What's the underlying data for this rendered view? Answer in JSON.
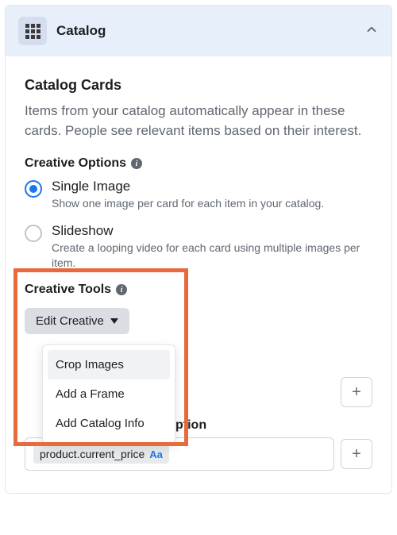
{
  "header": {
    "title": "Catalog"
  },
  "cards": {
    "title": "Catalog Cards",
    "description": "Items from your catalog automatically appear in these cards. People see relevant items based on their interest."
  },
  "creative_options": {
    "label": "Creative Options",
    "options": [
      {
        "title": "Single Image",
        "desc": "Show one image per card for each item in your catalog.",
        "selected": true
      },
      {
        "title": "Slideshow",
        "desc": "Create a looping video for each card using multiple images per item.",
        "selected": false
      }
    ]
  },
  "creative_tools": {
    "label": "Creative Tools",
    "button": "Edit Creative",
    "menu": [
      "Crop Images",
      "Add a Frame",
      "Add Catalog Info"
    ]
  },
  "desc_field": {
    "label_suffix": "ption",
    "token": "product.current_price"
  }
}
